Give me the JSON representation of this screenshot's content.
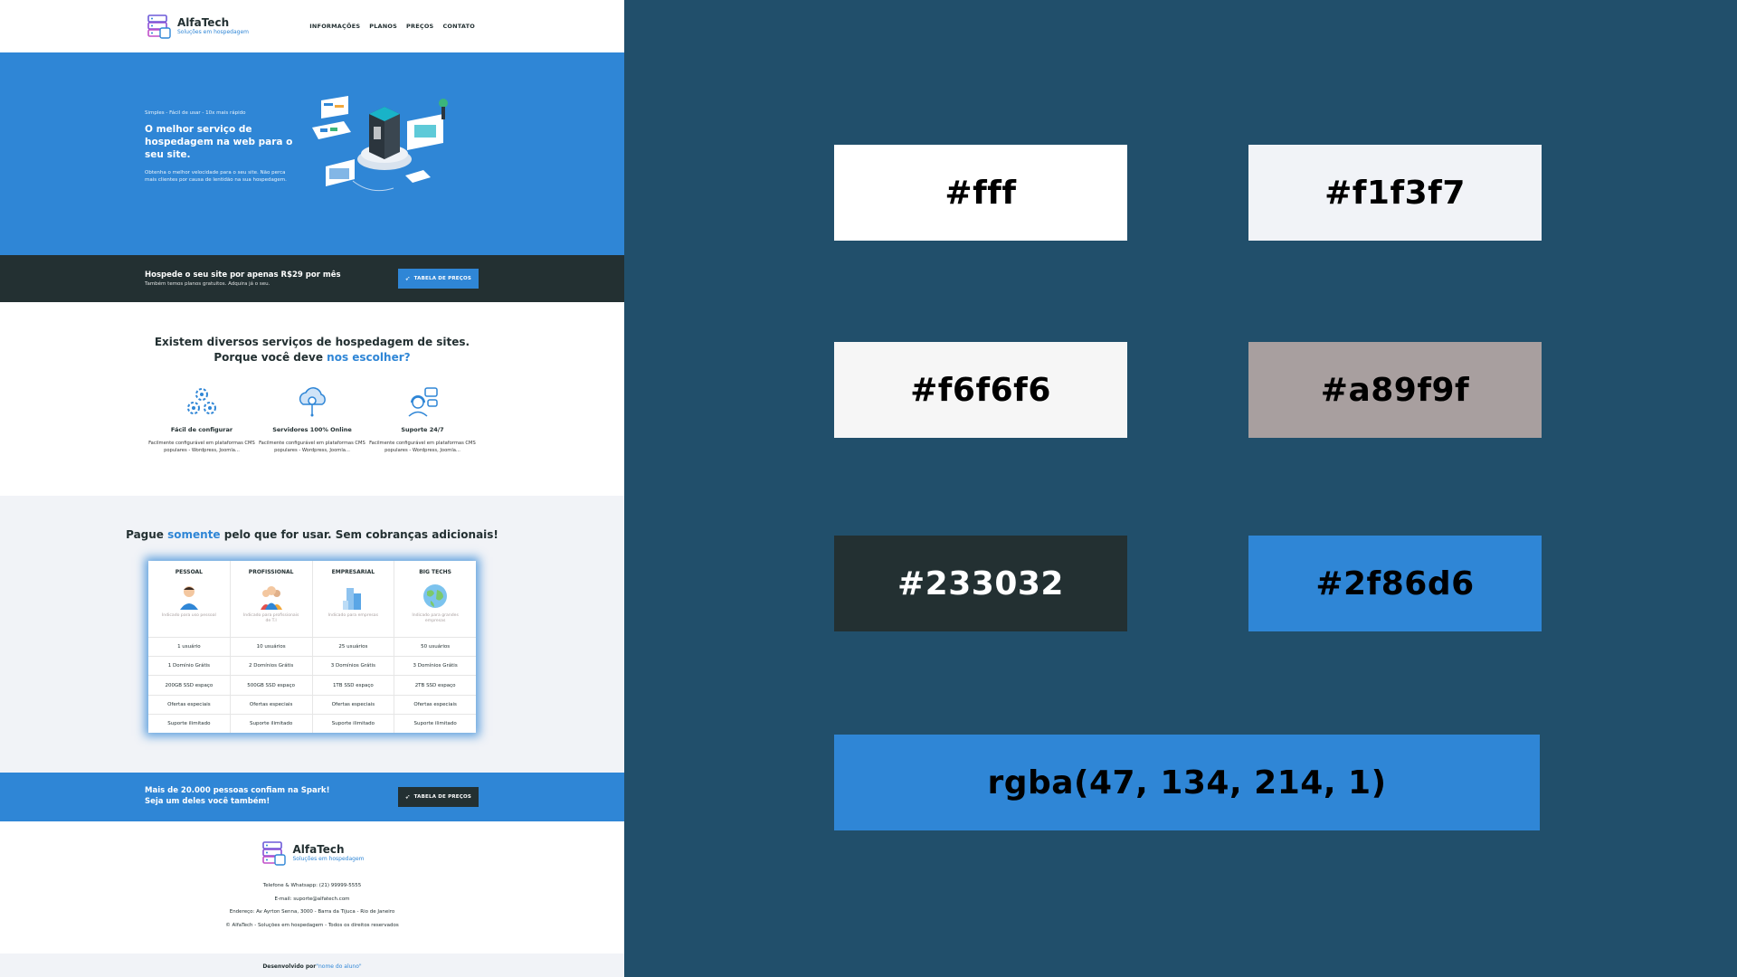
{
  "site": {
    "brand": {
      "name": "AlfaTech",
      "tagline": "Soluções em hospedagem"
    },
    "nav": [
      "INFORMAÇÕES",
      "PLANOS",
      "PREÇOS",
      "CONTATO"
    ],
    "hero": {
      "kicker": "Simples - Fácil de usar - 10x mais rápido",
      "title": "O melhor serviço de hospedagem na web para o seu site.",
      "description": "Obtenha o melhor velocidade para o seu site. Não perca mais clientes por causa de lentidão na sua hospedagem."
    },
    "cta_dark": {
      "title": "Hospede o seu site por apenas R$29 por mês",
      "subtitle": "Também temos planos gratuitos. Adquira já o seu.",
      "button": "TABELA DE PREÇOS"
    },
    "why": {
      "title_line1": "Existem diversos serviços de hospedagem de sites.",
      "title_line2_prefix": "Porque você deve ",
      "title_line2_highlight": "nos escolher?",
      "features": [
        {
          "title": "Fácil de configurar",
          "desc": "Facilmente configurável em plataformas CMS populares - Wordpress, Joomla..."
        },
        {
          "title": "Servidores 100% Online",
          "desc": "Facilmente configurável em plataformas CMS populares - Wordpress, Joomla..."
        },
        {
          "title": "Suporte 24/7",
          "desc": "Facilmente configurável em plataformas CMS populares - Wordpress, Joomla..."
        }
      ]
    },
    "pricing": {
      "title_prefix": "Pague ",
      "title_highlight": "somente",
      "title_suffix": " pelo que for usar. Sem cobranças adicionais!",
      "plans": [
        {
          "name": "PESSOAL",
          "note": "Indicado para uso pessoal",
          "rows": [
            "1 usuário",
            "1 Domínio Grátis",
            "200GB SSD espaço",
            "Ofertas especiais",
            "Suporte ilimitado"
          ]
        },
        {
          "name": "PROFISSIONAL",
          "note": "Indicado para profissionais de T.I",
          "rows": [
            "10 usuários",
            "2 Domínios Grátis",
            "500GB SSD espaço",
            "Ofertas especiais",
            "Suporte ilimitado"
          ]
        },
        {
          "name": "EMPRESARIAL",
          "note": "Indicado para empresas",
          "rows": [
            "25 usuários",
            "3 Domínios Grátis",
            "1TB SSD espaço",
            "Ofertas especiais",
            "Suporte ilimitado"
          ]
        },
        {
          "name": "BIG TECHS",
          "note": "Indicado para grandes empresas",
          "rows": [
            "50 usuários",
            "3 Domínios Grátis",
            "2TB SSD espaço",
            "Ofertas especiais",
            "Suporte ilimitado"
          ]
        }
      ]
    },
    "cta_blue": {
      "line1": "Mais de 20.000 pessoas confiam na Spark!",
      "line2": "Seja um deles você também!",
      "button": "TABELA DE PREÇOS"
    },
    "footer": {
      "phone": "Telefone & Whatsapp: (21) 99999-5555",
      "email": "E-mail: suporte@alfatech.com",
      "address": "Endereço: Av Ayrton Senna, 3000 - Barra da Tijuca - Rio de Janeiro",
      "copyright": "© AlfaTech - Soluções em hospedagem - Todos os direitos reservados",
      "dev_prefix": "Desenvolvido por ",
      "dev_name": "\"nome do aluno\""
    }
  },
  "palette": [
    {
      "label": "#fff",
      "color": "#ffffff",
      "text_color": "#000000"
    },
    {
      "label": "#f1f3f7",
      "color": "#f1f3f7",
      "text_color": "#000000"
    },
    {
      "label": "#f6f6f6",
      "color": "#f6f6f6",
      "text_color": "#000000"
    },
    {
      "label": "#a89f9f",
      "color": "#a89f9f",
      "text_color": "#000000"
    },
    {
      "label": "#233032",
      "color": "#233032",
      "text_color": "#ffffff"
    },
    {
      "label": "#2f86d6",
      "color": "#2f86d6",
      "text_color": "#000000"
    },
    {
      "label": "rgba(47, 134, 214, 1)",
      "color": "#2f86d6",
      "text_color": "#000000"
    }
  ],
  "background_color": "#214f6b"
}
